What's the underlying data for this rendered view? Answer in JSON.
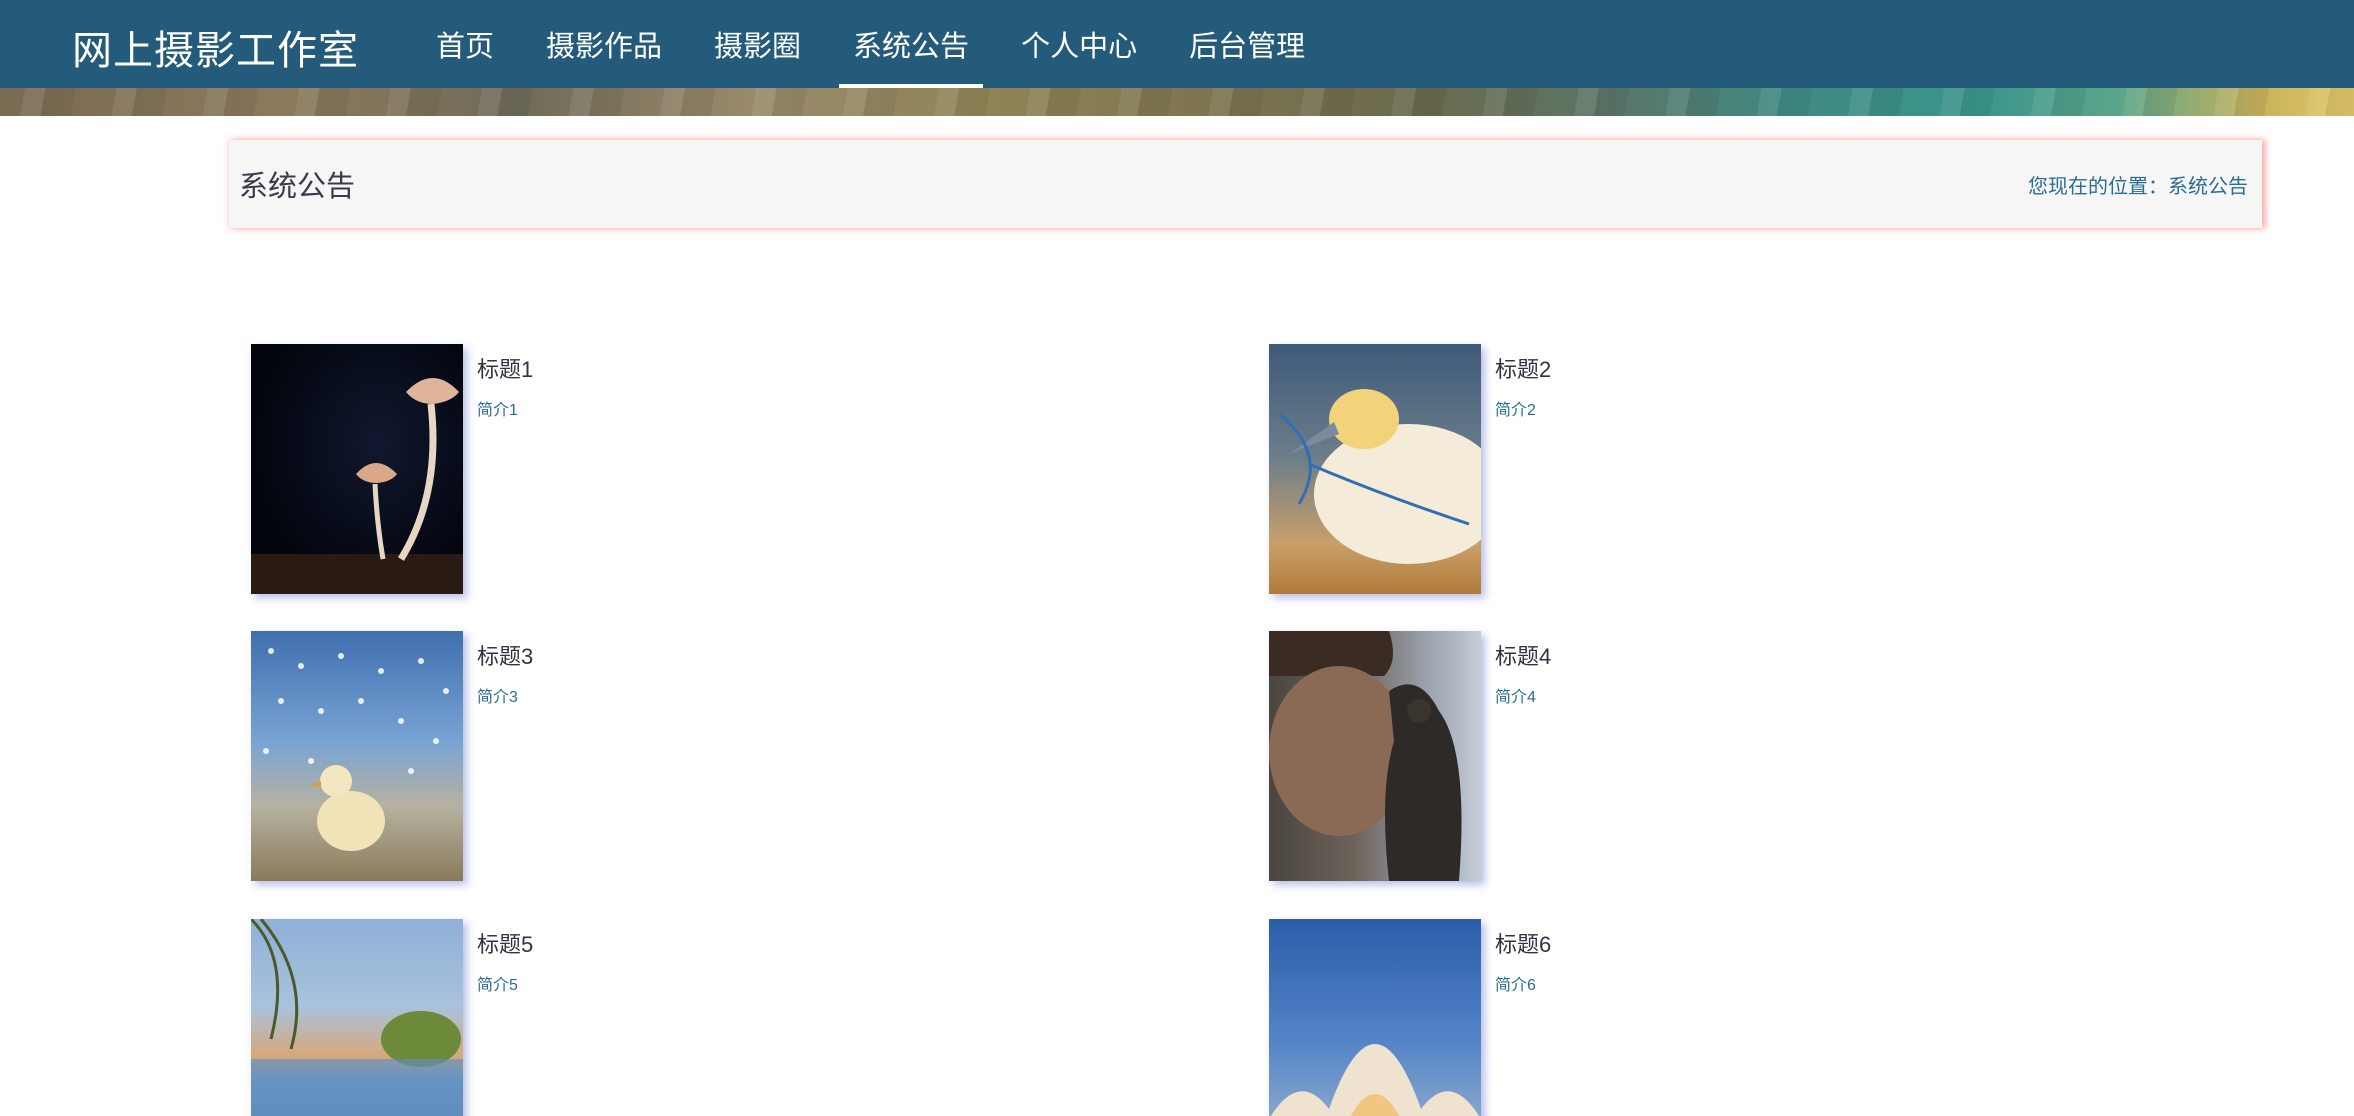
{
  "site": {
    "title": "网上摄影工作室"
  },
  "nav": {
    "items": [
      {
        "label": "首页"
      },
      {
        "label": "摄影作品"
      },
      {
        "label": "摄影圈"
      },
      {
        "label": "系统公告"
      },
      {
        "label": "个人中心"
      },
      {
        "label": "后台管理"
      }
    ],
    "active": "系统公告"
  },
  "breadcrumb": {
    "title": "系统公告",
    "location": "您现在的位置：系统公告"
  },
  "notices": [
    {
      "title": "标题1",
      "desc": "简介1",
      "image": "mushrooms-photo"
    },
    {
      "title": "标题2",
      "desc": "简介2",
      "image": "gannet-bird-photo"
    },
    {
      "title": "标题3",
      "desc": "简介3",
      "image": "chick-and-birds-photo"
    },
    {
      "title": "标题4",
      "desc": "简介4",
      "image": "falconer-portrait-photo"
    },
    {
      "title": "标题5",
      "desc": "简介5",
      "image": "lake-landscape-photo"
    },
    {
      "title": "标题6",
      "desc": "简介6",
      "image": "architecture-dusk-photo"
    }
  ],
  "colors": {
    "navbar": "#245a7a",
    "link": "#2b6d92",
    "crumb_bg": "#f6f6f6"
  }
}
